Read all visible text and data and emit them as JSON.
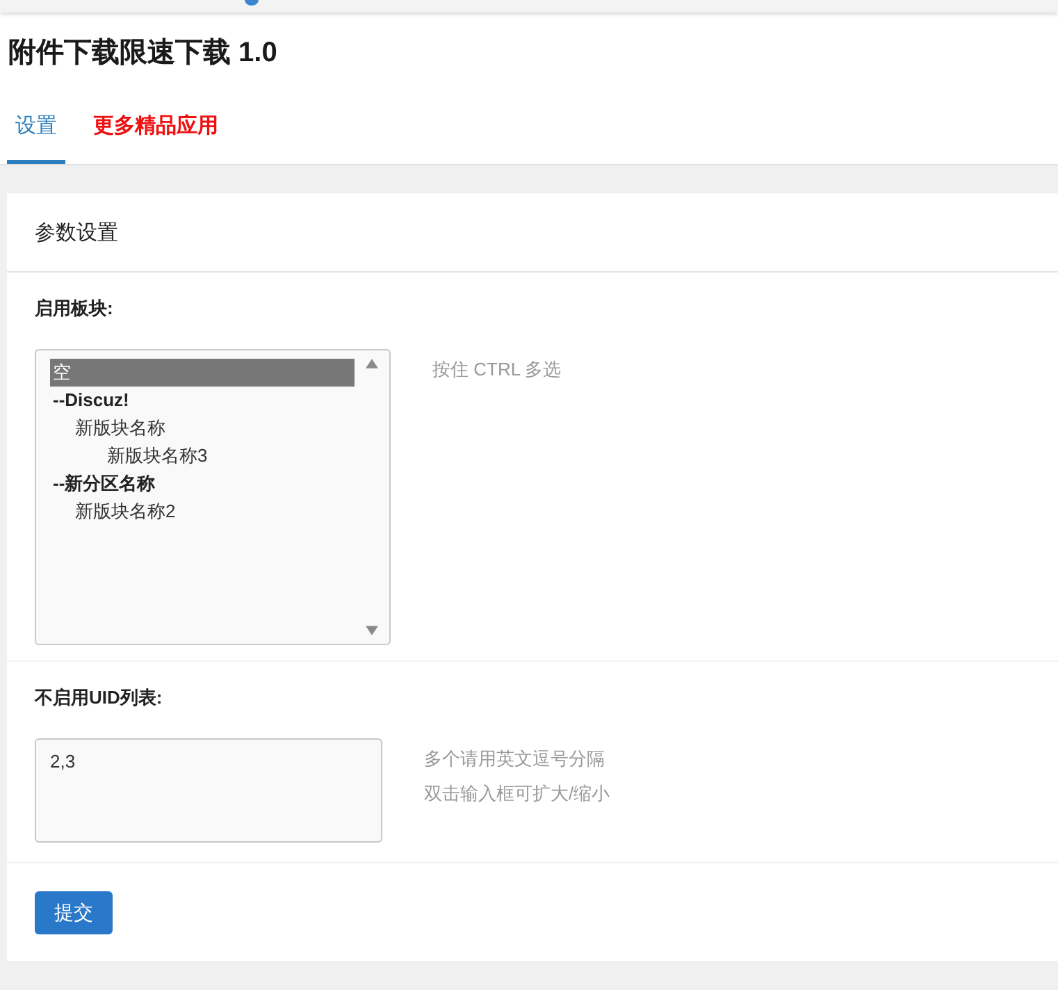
{
  "title": "附件下载限速下载 1.0",
  "tabs": [
    {
      "label": "设置",
      "selected": true,
      "kind": "normal"
    },
    {
      "label": "更多精品应用",
      "selected": false,
      "kind": "promo"
    }
  ],
  "panel": {
    "title": "参数设置",
    "fields": [
      {
        "kind": "select",
        "label": "启用板块:",
        "options": [
          {
            "label": "空",
            "selected": true,
            "kind": "option"
          },
          {
            "label": "--Discuz!",
            "selected": false,
            "kind": "group",
            "children": [
              {
                "label": "新版块名称",
                "selected": false,
                "children": [
                  {
                    "label": "新版块名称3",
                    "selected": false
                  }
                ]
              }
            ]
          },
          {
            "label": "--新分区名称",
            "selected": false,
            "kind": "group",
            "children": [
              {
                "label": "新版块名称2",
                "selected": false
              }
            ]
          }
        ],
        "hints": [
          "按住 CTRL 多选"
        ]
      },
      {
        "kind": "textarea",
        "label": "不启用UID列表:",
        "value": "2,3",
        "hints": [
          "多个请用英文逗号分隔",
          "双击输入框可扩大/缩小"
        ]
      }
    ],
    "submit": "提交"
  }
}
